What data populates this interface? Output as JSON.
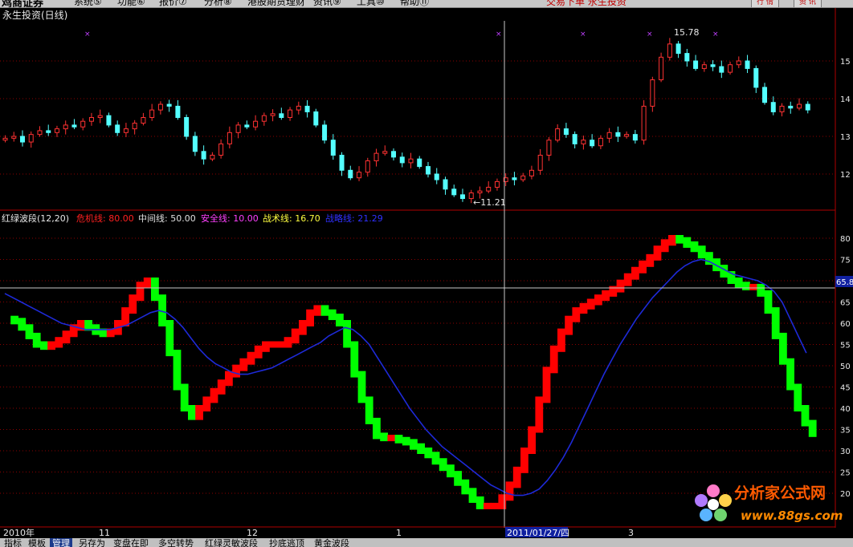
{
  "menubar": {
    "logo": "鸡商证券",
    "items": [
      "系统⑤",
      "功能⑥",
      "报价⑦",
      "分析⑧",
      "港股期货理财",
      "资讯⑨",
      "工具⑩",
      "帮助⑪"
    ],
    "center_text": "交易下单  永生投资",
    "buttons": [
      "行 情",
      "资 讯"
    ]
  },
  "upper_panel": {
    "stock_name": "永生投资(日线)",
    "price_ticks": [
      "15",
      "14",
      "13",
      "12"
    ],
    "high_label": "15.78",
    "low_label": "←11.21"
  },
  "indicator_panel": {
    "legend_name": "红绿波段(12,20)",
    "legend": [
      {
        "label": "危机线: 80.00",
        "color": "#ff2020"
      },
      {
        "label": "中间线: 50.00",
        "color": "#e0e0e0"
      },
      {
        "label": "安全线: 10.00",
        "color": "#ff40ff"
      },
      {
        "label": "战术线: 16.70",
        "color": "#ffff40"
      },
      {
        "label": "战略线: 21.29",
        "color": "#3030ff"
      }
    ],
    "y_ticks": [
      "80",
      "75",
      "70",
      "65",
      "60",
      "55",
      "50",
      "45",
      "40",
      "35",
      "30",
      "25",
      "20"
    ],
    "crosshair_value": "65.8"
  },
  "date_axis": {
    "labels": [
      "2010年",
      "11",
      "12",
      "1",
      "3"
    ],
    "cursor_date": "2011/01/27/四"
  },
  "bottom_tabs": [
    "指标",
    "模板",
    "管理",
    "另存为",
    "变盘在即",
    "多空转势",
    "红绿灵敏波段",
    "抄底逃顶",
    "黄金波段"
  ],
  "active_tab": "管理",
  "watermark": {
    "title": "分析家公式网",
    "url": "www.88gs.com"
  },
  "colors": {
    "up_candle": "#ff3232",
    "down_candle": "#54ffff",
    "up_band": "#ff0000",
    "down_band": "#00ff00",
    "strategic_line": "#1e2ad8",
    "grid": "#8b0000"
  },
  "chart_data": [
    {
      "type": "candlestick",
      "title": "永生投资(日线)",
      "price_labels": [
        15,
        14,
        13,
        12
      ],
      "high": 15.78,
      "low": 11.21,
      "close": [
        12.95,
        13.0,
        12.85,
        13.05,
        13.15,
        13.1,
        13.2,
        13.3,
        13.25,
        13.4,
        13.5,
        13.55,
        13.3,
        13.1,
        13.2,
        13.35,
        13.5,
        13.7,
        13.85,
        13.8,
        13.5,
        13.0,
        12.6,
        12.4,
        12.5,
        12.8,
        13.1,
        13.3,
        13.25,
        13.4,
        13.55,
        13.6,
        13.5,
        13.7,
        13.8,
        13.65,
        13.3,
        12.9,
        12.5,
        12.1,
        11.9,
        12.05,
        12.35,
        12.55,
        12.6,
        12.45,
        12.3,
        12.4,
        12.2,
        12.0,
        11.85,
        11.6,
        11.45,
        11.35,
        11.5,
        11.55,
        11.65,
        11.8,
        11.9,
        11.85,
        11.95,
        12.1,
        12.5,
        12.9,
        13.2,
        13.05,
        12.8,
        12.9,
        12.75,
        12.95,
        13.1,
        13.0,
        13.05,
        12.9,
        13.8,
        14.5,
        15.1,
        15.45,
        15.2,
        15.0,
        14.8,
        14.9,
        14.85,
        14.7,
        14.9,
        15.0,
        14.8,
        14.3,
        13.9,
        13.65,
        13.8,
        13.75,
        13.85,
        13.7
      ]
    },
    {
      "type": "line",
      "title": "红绿波段(12,20)",
      "ylim": [
        16,
        82
      ],
      "reference_lines": {
        "危机线": 80.0,
        "中间线": 50.0,
        "安全线": 10.0,
        "战术线": 16.7,
        "战略线": 21.29
      },
      "series": [
        {
          "name": "红绿波段",
          "values": [
            61,
            60.5,
            59,
            57,
            55,
            54.5,
            55,
            56,
            57.5,
            59,
            60,
            59,
            58,
            57.5,
            58,
            60,
            63,
            66,
            69,
            70,
            66,
            60,
            53,
            45,
            40,
            38,
            40,
            42,
            44,
            46,
            48,
            49.5,
            51,
            52.5,
            54,
            55,
            55,
            55,
            56,
            58,
            60,
            62.5,
            63.5,
            62.5,
            61.5,
            60,
            55,
            48,
            42,
            37,
            33.5,
            33,
            33,
            32.5,
            32,
            31,
            30,
            29,
            27.5,
            26,
            24.5,
            22.5,
            20.5,
            18.5,
            17,
            17,
            17,
            19,
            22,
            25.5,
            30,
            35,
            42,
            49,
            54,
            58,
            61,
            63,
            64,
            65,
            66,
            67,
            68,
            69.5,
            71,
            72.5,
            74,
            75.5,
            77.5,
            79,
            80,
            79.5,
            78.5,
            77.5,
            76,
            74.5,
            73,
            71.5,
            70,
            69,
            68.5,
            68.5,
            67,
            63,
            57,
            51,
            45,
            40,
            36.5,
            34
          ]
        },
        {
          "name": "战略线",
          "values": [
            67,
            66,
            65,
            64,
            63,
            62,
            61,
            60,
            59.5,
            59,
            58.5,
            58.5,
            58.5,
            58.5,
            59,
            59.5,
            60.5,
            61.5,
            62.5,
            63,
            62.5,
            61,
            59,
            56.5,
            54,
            52,
            50.5,
            49.5,
            48.5,
            48,
            48,
            48.5,
            49,
            49.5,
            50.5,
            51.5,
            52.5,
            53.5,
            54.5,
            55.5,
            57,
            58,
            59,
            58.5,
            57,
            55,
            52,
            49,
            46,
            43,
            40,
            37.5,
            35,
            33,
            31,
            29.5,
            28,
            26.5,
            25,
            23.5,
            22,
            21,
            20,
            19.5,
            19.5,
            20,
            21,
            23,
            25.5,
            28.5,
            32,
            36,
            40,
            44,
            48,
            51.5,
            55,
            58,
            61,
            63.5,
            66,
            68,
            70,
            72,
            73.5,
            74.5,
            75,
            74.5,
            73.5,
            72.5,
            71.5,
            71,
            70.5,
            70,
            69,
            67.5,
            65,
            61,
            57,
            53
          ]
        }
      ]
    }
  ]
}
